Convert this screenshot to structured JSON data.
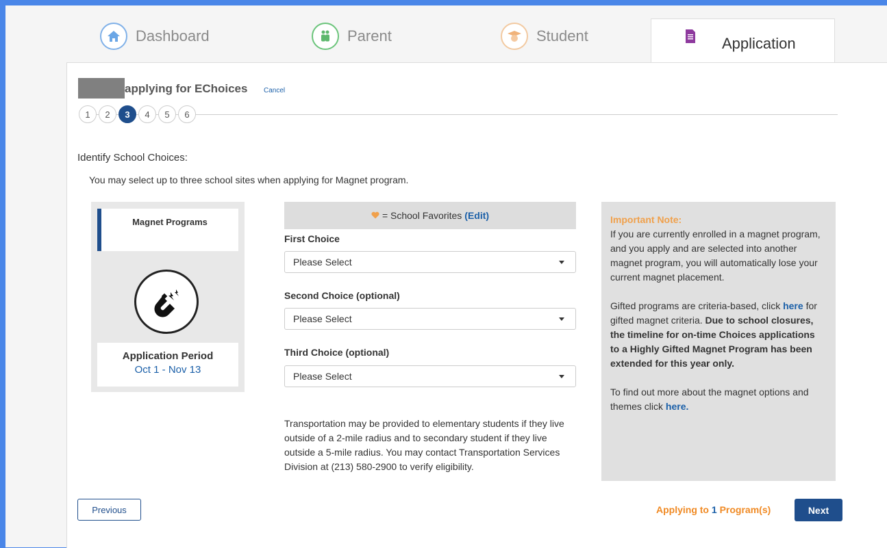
{
  "tabs": [
    {
      "label": "Dashboard",
      "icon": "home-icon"
    },
    {
      "label": "Parent",
      "icon": "parent-icon"
    },
    {
      "label": "Student",
      "icon": "student-icon"
    },
    {
      "label": "Application",
      "icon": "document-icon"
    }
  ],
  "header": {
    "title": "applying for EChoices",
    "cancel": "Cancel"
  },
  "steps": [
    "1",
    "2",
    "3",
    "4",
    "5",
    "6"
  ],
  "active_step": "3",
  "section": {
    "heading": "Identify School Choices:",
    "subtext": "You may select up to three school sites when applying for Magnet program."
  },
  "program_card": {
    "title": "Magnet Programs",
    "icon": "magnet-icon",
    "period_label": "Application Period",
    "period_value": "Oct 1 - Nov 13"
  },
  "favorites": {
    "text": "= School Favorites",
    "edit": "(Edit)"
  },
  "choices": [
    {
      "label": "First Choice",
      "value": "Please Select"
    },
    {
      "label": "Second Choice (optional)",
      "value": "Please Select"
    },
    {
      "label": "Third Choice (optional)",
      "value": "Please Select"
    }
  ],
  "transport_text": "Transportation may be provided to elementary students if they live outside of a 2-mile radius and to secondary student if they live outside a 5-mile radius. You may contact Transportation Services Division at (213) 580-2900 to verify eligibility.",
  "note": {
    "heading": "Important Note:",
    "para1": "If you are currently enrolled in a magnet program, and you apply and are selected into another magnet program, you will automatically lose your current magnet placement.",
    "para2_a": "Gifted programs are criteria-based, click",
    "para2_link": "here",
    "para2_b": "for gifted magnet criteria.",
    "para2_bold": "Due to school closures, the timeline for on-time Choices applications to a Highly Gifted Magnet Program has been extended for this year only.",
    "para3_a": "To find out more about the magnet options and themes click",
    "para3_link": "here."
  },
  "footer": {
    "previous": "Previous",
    "applying_pre": "Applying to",
    "applying_count": "1",
    "applying_post": "Program(s)",
    "next": "Next"
  },
  "colors": {
    "primary": "#1f4e8c",
    "accent_orange": "#f08a24",
    "link": "#1a5fa8",
    "background": "#4a86e8"
  }
}
